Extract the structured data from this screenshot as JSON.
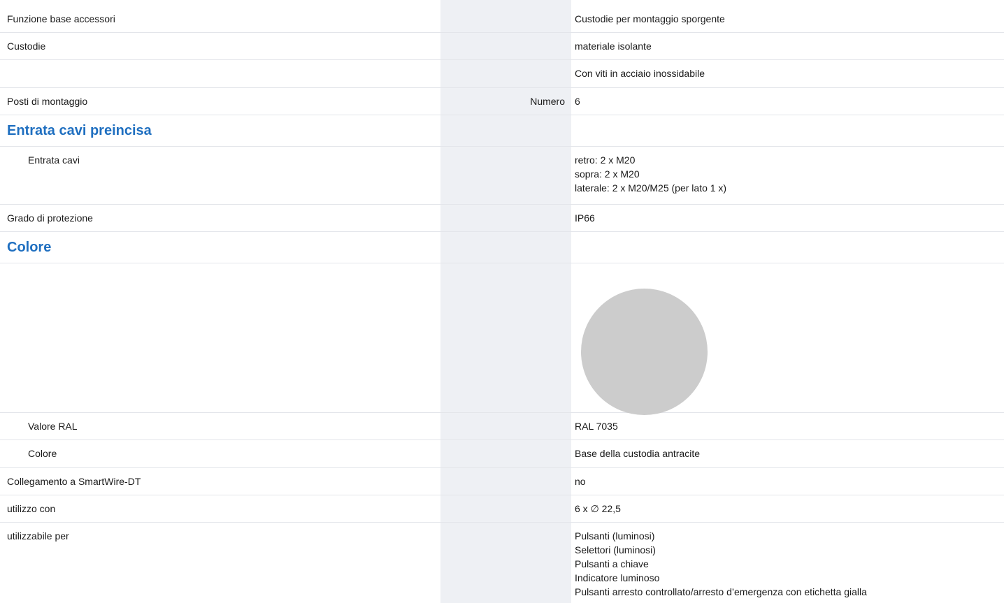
{
  "colors": {
    "section_heading": "#1f6fc0",
    "unit_column_bg": "#eef0f4",
    "row_divider": "#e3e5ea",
    "swatch": "#cccccc"
  },
  "rows": {
    "r0": {
      "label": "Funzione base accessori",
      "value": "Custodie per montaggio sporgente"
    },
    "r1": {
      "label": "Custodie",
      "value": "materiale isolante"
    },
    "r2": {
      "label": "",
      "value": "Con viti in acciaio inossidabile"
    },
    "r3": {
      "label": "Posti di montaggio",
      "unit": "Numero",
      "value": "6"
    },
    "s1": {
      "heading": "Entrata cavi preincisa"
    },
    "r4": {
      "label": "Entrata cavi",
      "lines": [
        "retro: 2 x M20",
        "sopra: 2 x M20",
        "laterale: 2 x M20/M25 (per lato 1 x)"
      ]
    },
    "r5": {
      "label": "Grado di protezione",
      "value": "IP66"
    },
    "s2": {
      "heading": "Colore"
    },
    "swatch": {
      "icon": "color-swatch-circle"
    },
    "r6": {
      "label": "Valore RAL",
      "value": "RAL 7035"
    },
    "r7": {
      "label": "Colore",
      "value": "Base della custodia antracite"
    },
    "r8": {
      "label": "Collegamento a SmartWire-DT",
      "value": "no"
    },
    "r9": {
      "label": "utilizzo con",
      "value": "6 x ∅ 22,5"
    },
    "r10": {
      "label": "utilizzabile per",
      "lines": [
        "Pulsanti (luminosi)",
        "Selettori (luminosi)",
        "Pulsanti a chiave",
        "Indicatore luminoso",
        "Pulsanti arresto controllato/arresto d’emergenza con etichetta gialla"
      ]
    }
  }
}
